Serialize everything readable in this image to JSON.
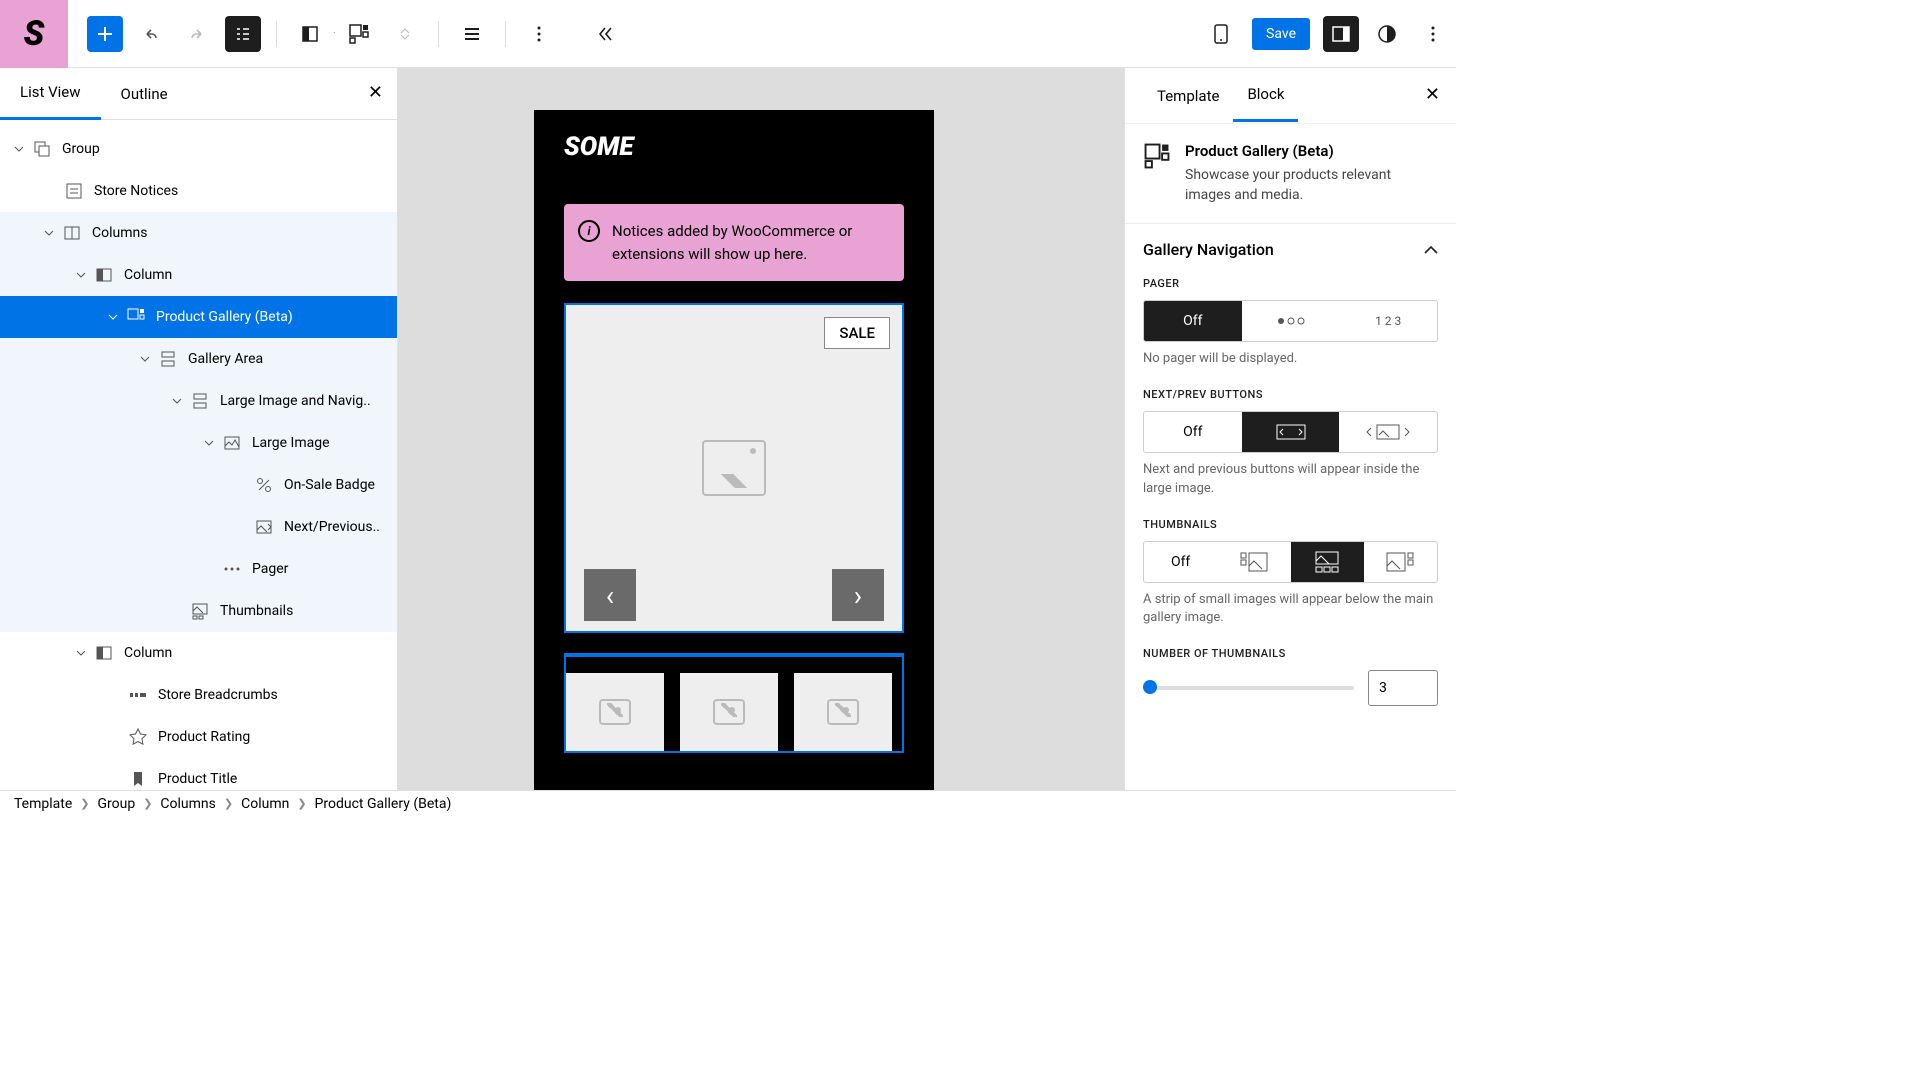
{
  "toolbar": {
    "save_label": "Save"
  },
  "left_panel": {
    "tab_list_view": "List View",
    "tab_outline": "Outline"
  },
  "tree": {
    "group": "Group",
    "store_notices": "Store Notices",
    "columns": "Columns",
    "column": "Column",
    "product_gallery": "Product Gallery (Beta)",
    "gallery_area": "Gallery Area",
    "large_image_navig": "Large Image and Navig..",
    "large_image": "Large Image",
    "on_sale_badge": "On-Sale Badge",
    "next_previous": "Next/Previous..",
    "pager": "Pager",
    "thumbnails": "Thumbnails",
    "column2": "Column",
    "store_breadcrumbs": "Store Breadcrumbs",
    "product_rating": "Product Rating",
    "product_title": "Product Title"
  },
  "preview": {
    "brand": "SOME",
    "notice": "Notices added by WooCommerce or extensions will show up here.",
    "sale": "SALE"
  },
  "right_panel": {
    "tab_template": "Template",
    "tab_block": "Block",
    "block_title": "Product Gallery (Beta)",
    "block_desc": "Showcase your products relevant images and media.",
    "section_gallery_nav": "Gallery Navigation",
    "pager_label": "PAGER",
    "pager_off": "Off",
    "pager_numbers": "1 2 3",
    "pager_help": "No pager will be displayed.",
    "nextprev_label": "NEXT/PREV BUTTONS",
    "nextprev_off": "Off",
    "nextprev_help": "Next and previous buttons will appear inside the large image.",
    "thumbs_label": "THUMBNAILS",
    "thumbs_off": "Off",
    "thumbs_help": "A strip of small images will appear below the main gallery image.",
    "num_thumbs_label": "NUMBER OF THUMBNAILS",
    "num_thumbs_value": "3"
  },
  "breadcrumb": {
    "items": [
      "Template",
      "Group",
      "Columns",
      "Column",
      "Product Gallery (Beta)"
    ]
  }
}
